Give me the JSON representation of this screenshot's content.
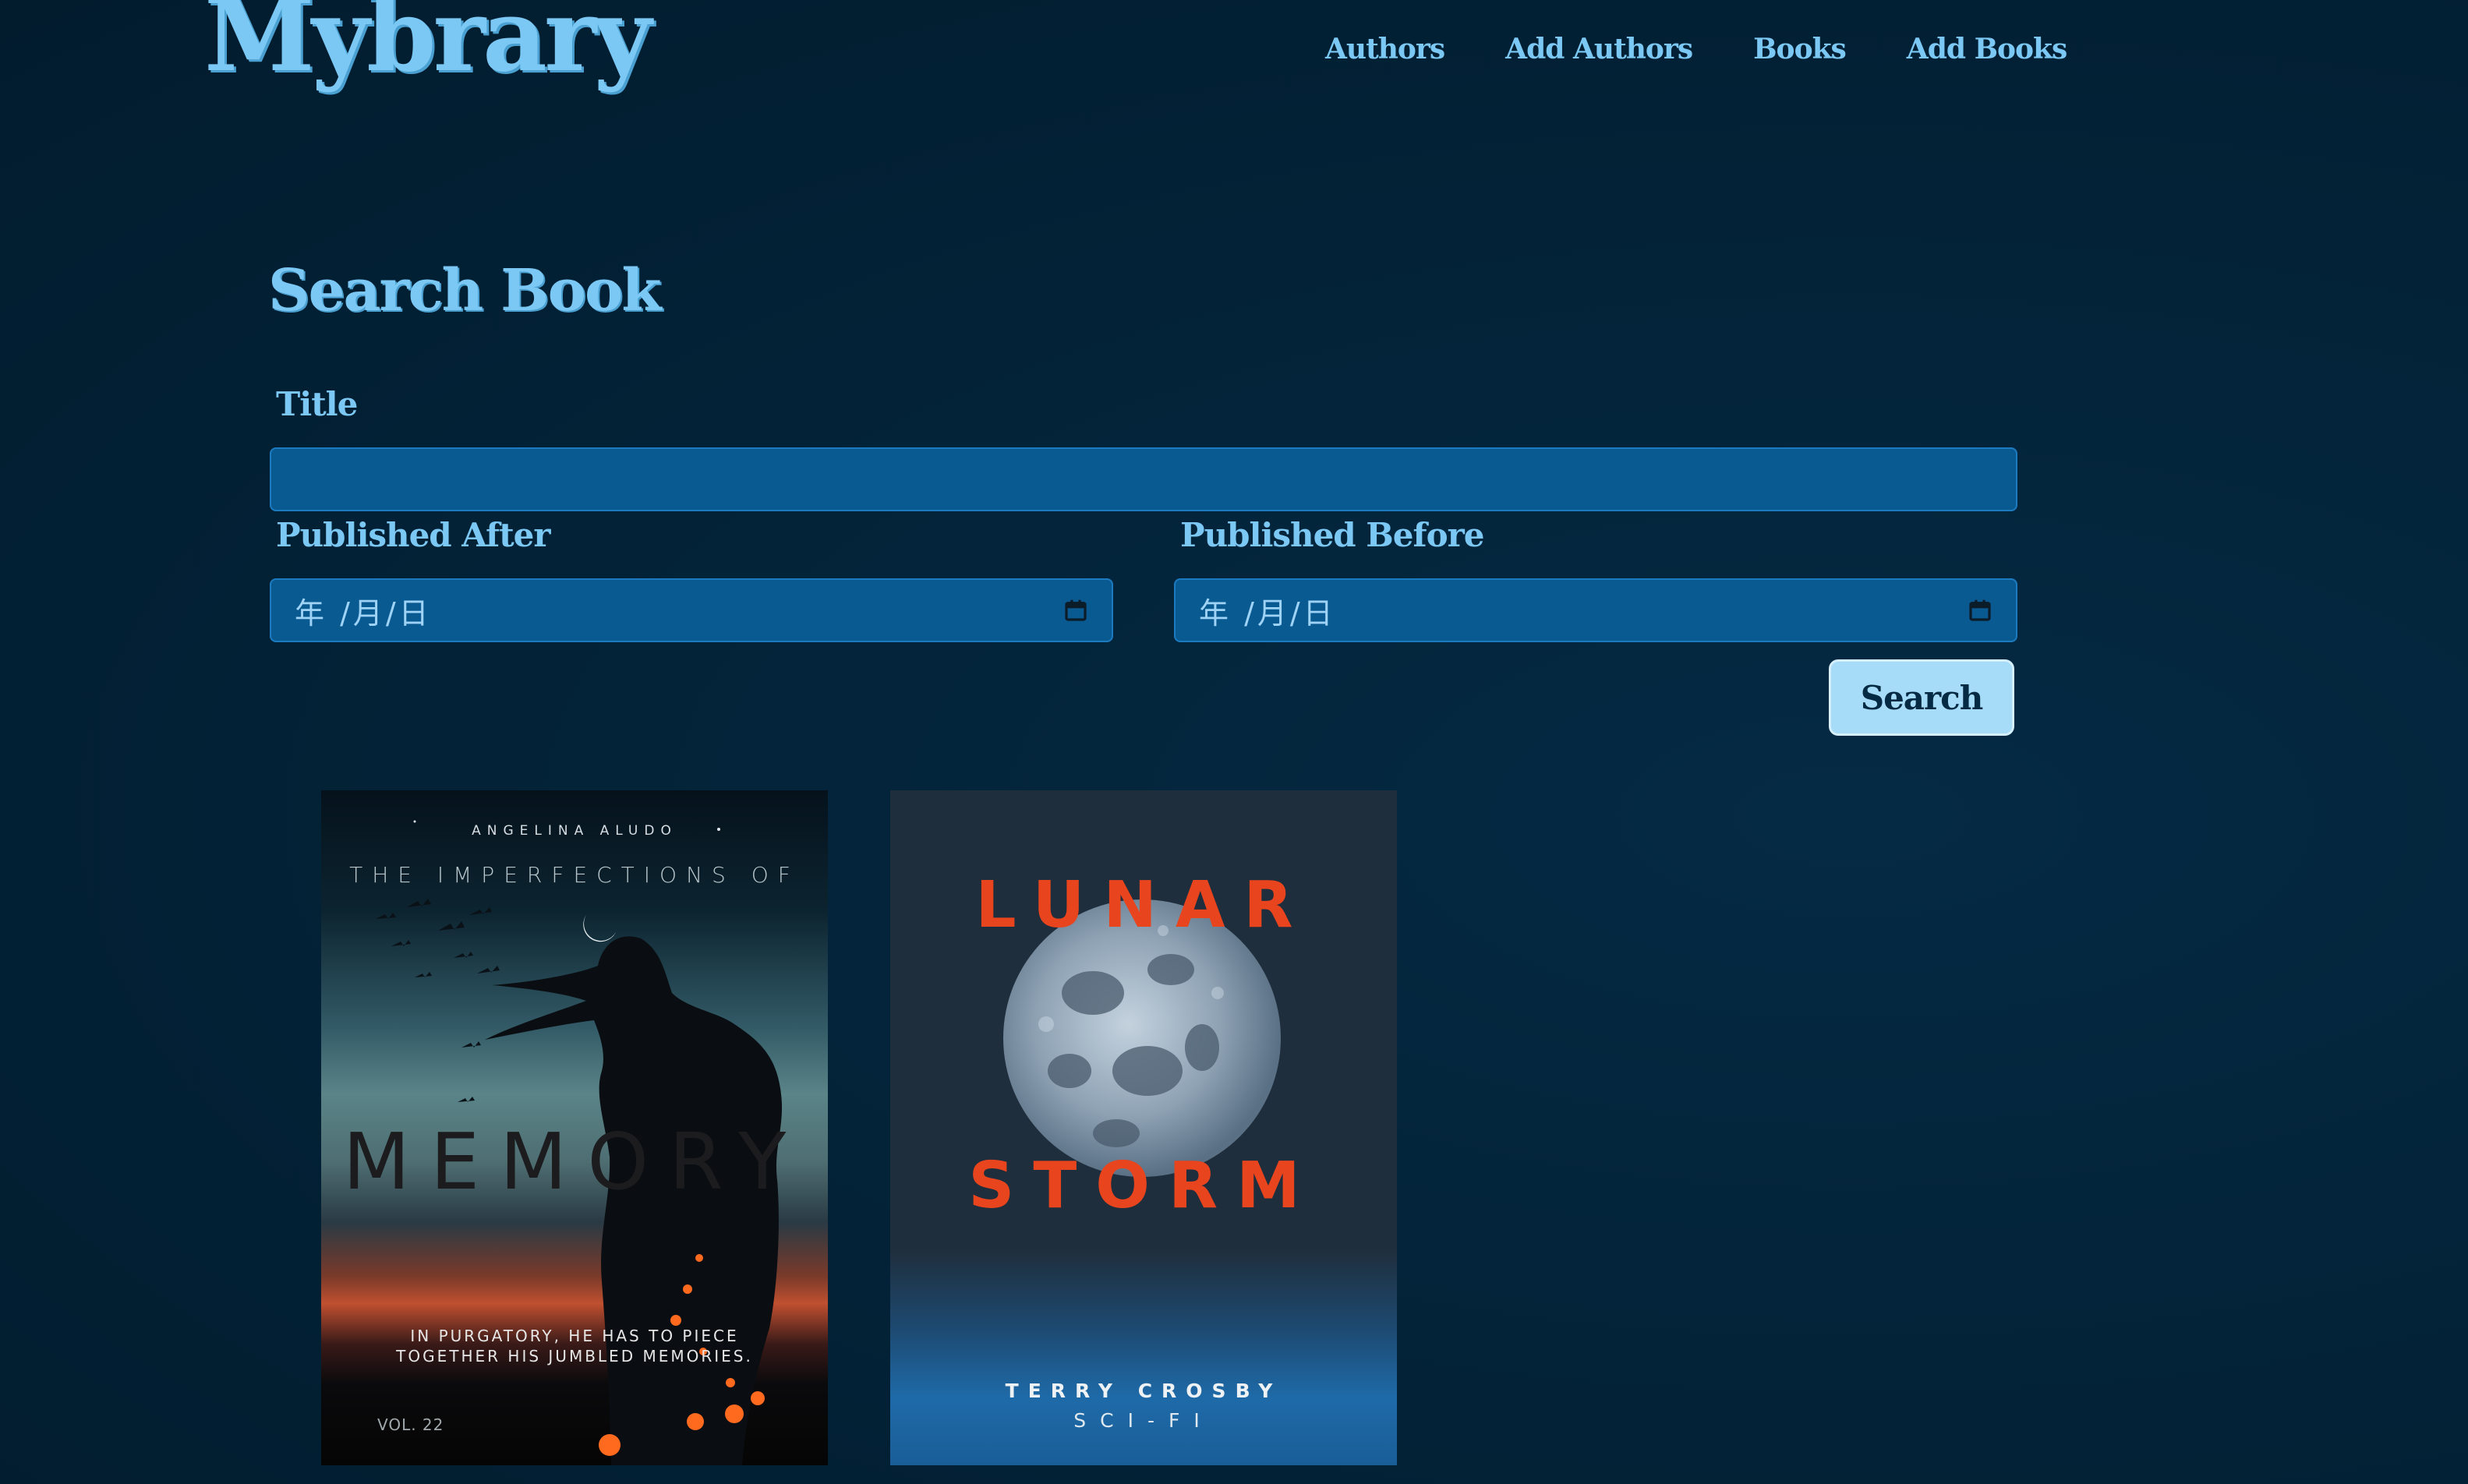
{
  "header": {
    "logo": "Mybrary",
    "nav": [
      {
        "label": "Authors"
      },
      {
        "label": "Add Authors"
      },
      {
        "label": "Books"
      },
      {
        "label": "Add Books"
      }
    ]
  },
  "search": {
    "title": "Search Book",
    "title_label": "Title",
    "title_value": "",
    "published_after_label": "Published After",
    "published_after_placeholder": "年 /月/日",
    "published_before_label": "Published Before",
    "published_before_placeholder": "年 /月/日",
    "button_label": "Search"
  },
  "books": [
    {
      "author": "ANGELINA ALUDO",
      "subtitle": "THE IMPERFECTIONS OF",
      "title": "MEMORY",
      "tagline_1": "IN PURGATORY, HE HAS TO PIECE",
      "tagline_2": "TOGETHER HIS JUMBLED MEMORIES.",
      "volume": "VOL. 22"
    },
    {
      "title_top": "LUNAR",
      "title_bottom": "STORM",
      "author": "TERRY CROSBY",
      "genre": "SCI-FI"
    }
  ],
  "colors": {
    "accent": "#7cc8f4",
    "input_bg": "#0a5a92",
    "button_bg": "#a6dcf8",
    "lunar_title": "#e8441e"
  },
  "icons": {
    "date": "calendar-icon"
  }
}
